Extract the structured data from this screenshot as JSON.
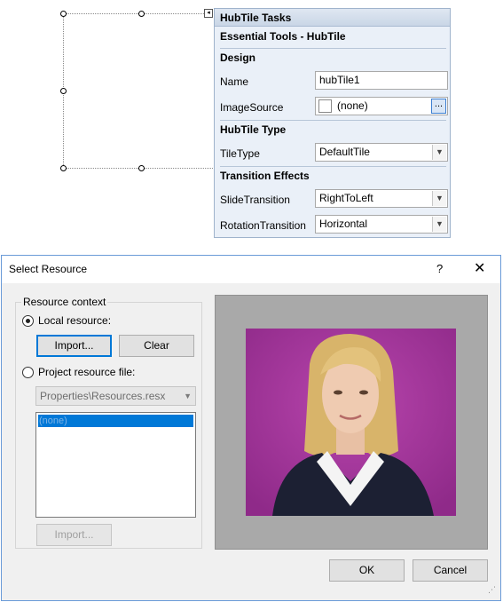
{
  "tasks_panel": {
    "title": "HubTile Tasks",
    "subtitle": "Essential Tools - HubTile",
    "design_section": "Design",
    "name_label": "Name",
    "name_value": "hubTile1",
    "image_source_label": "ImageSource",
    "image_source_value": "(none)",
    "ellipsis_label": "...",
    "hubtile_type_section": "HubTile Type",
    "tile_type_label": "TileType",
    "tile_type_value": "DefaultTile",
    "transition_section": "Transition Effects",
    "slide_label": "SlideTransition",
    "slide_value": "RightToLeft",
    "rotation_label": "RotationTransition",
    "rotation_value": "Horizontal"
  },
  "dialog": {
    "title": "Select Resource",
    "help_glyph": "?",
    "close_glyph": "✕",
    "group_title": "Resource context",
    "local_resource_label": "Local resource:",
    "import_label": "Import...",
    "clear_label": "Clear",
    "project_resource_label": "Project resource file:",
    "project_file_value": "Properties\\Resources.resx",
    "list_items": [
      "(none)"
    ],
    "project_import_label": "Import...",
    "ok_label": "OK",
    "cancel_label": "Cancel",
    "local_selected": true
  },
  "colors": {
    "photo_background": "#a2359a",
    "accent": "#0078d7"
  }
}
